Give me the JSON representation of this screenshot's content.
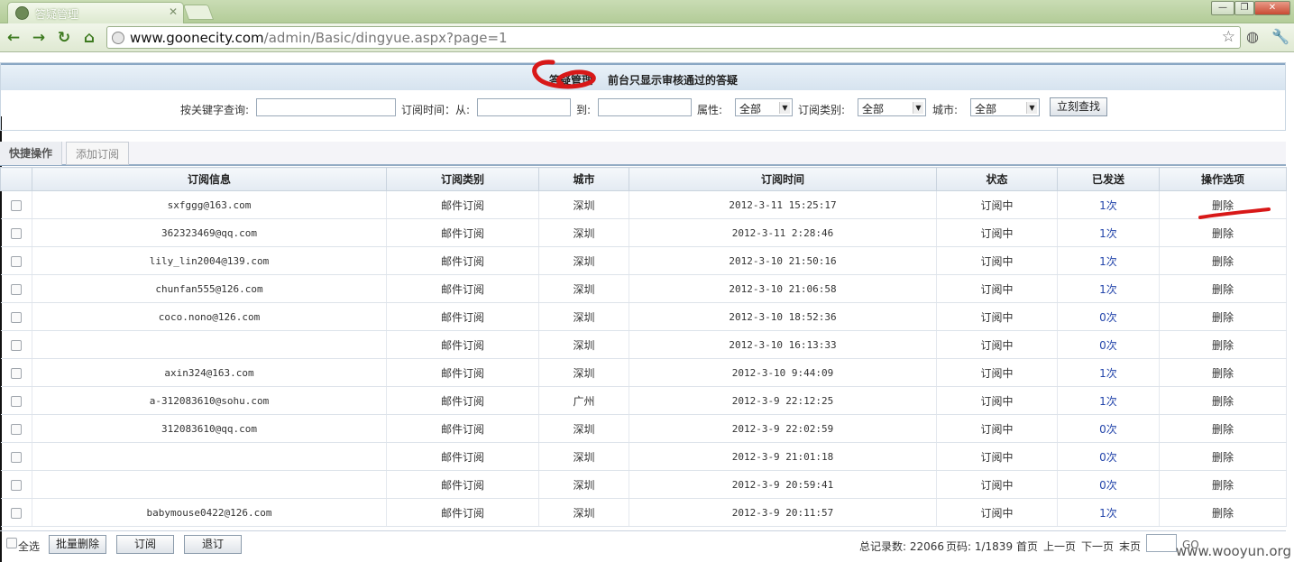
{
  "browser": {
    "tab_title": "答疑管理",
    "url_host": "www.goonecity.com",
    "url_path": "/admin/Basic/dingyue.aspx?page=1"
  },
  "panel": {
    "title": "答疑管理",
    "subtitle": "前台只显示审核通过的答疑"
  },
  "search": {
    "keyword_label": "按关键字查询:",
    "time_from_label": "订阅时间：从:",
    "time_to_label": "到:",
    "attr_label": "属性:",
    "attr_value": "全部",
    "type_label": "订阅类别:",
    "type_value": "全部",
    "city_label": "城市:",
    "city_value": "全部",
    "search_button": "立刻查找"
  },
  "quick": {
    "active_tab": "快捷操作",
    "add_tab": "添加订阅"
  },
  "table": {
    "headers": [
      "订阅信息",
      "订阅类别",
      "城市",
      "订阅时间",
      "状态",
      "已发送",
      "操作选项"
    ],
    "rows": [
      {
        "info": "sxfggg@163.com",
        "type": "邮件订阅",
        "city": "深圳",
        "time": "2012-3-11 15:25:17",
        "status": "订阅中",
        "sent": "1次",
        "action": "删除"
      },
      {
        "info": "362323469@qq.com",
        "type": "邮件订阅",
        "city": "深圳",
        "time": "2012-3-11 2:28:46",
        "status": "订阅中",
        "sent": "1次",
        "action": "删除"
      },
      {
        "info": "lily_lin2004@139.com",
        "type": "邮件订阅",
        "city": "深圳",
        "time": "2012-3-10 21:50:16",
        "status": "订阅中",
        "sent": "1次",
        "action": "删除"
      },
      {
        "info": "chunfan555@126.com",
        "type": "邮件订阅",
        "city": "深圳",
        "time": "2012-3-10 21:06:58",
        "status": "订阅中",
        "sent": "1次",
        "action": "删除"
      },
      {
        "info": "coco.nono@126.com",
        "type": "邮件订阅",
        "city": "深圳",
        "time": "2012-3-10 18:52:36",
        "status": "订阅中",
        "sent": "0次",
        "action": "删除"
      },
      {
        "info": "",
        "type": "邮件订阅",
        "city": "深圳",
        "time": "2012-3-10 16:13:33",
        "status": "订阅中",
        "sent": "0次",
        "action": "删除"
      },
      {
        "info": "axin324@163.com",
        "type": "邮件订阅",
        "city": "深圳",
        "time": "2012-3-10 9:44:09",
        "status": "订阅中",
        "sent": "1次",
        "action": "删除"
      },
      {
        "info": "a-312083610@sohu.com",
        "type": "邮件订阅",
        "city": "广州",
        "time": "2012-3-9 22:12:25",
        "status": "订阅中",
        "sent": "1次",
        "action": "删除"
      },
      {
        "info": "312083610@qq.com",
        "type": "邮件订阅",
        "city": "深圳",
        "time": "2012-3-9 22:02:59",
        "status": "订阅中",
        "sent": "0次",
        "action": "删除"
      },
      {
        "info": "",
        "type": "邮件订阅",
        "city": "深圳",
        "time": "2012-3-9 21:01:18",
        "status": "订阅中",
        "sent": "0次",
        "action": "删除"
      },
      {
        "info": "",
        "type": "邮件订阅",
        "city": "深圳",
        "time": "2012-3-9 20:59:41",
        "status": "订阅中",
        "sent": "0次",
        "action": "删除"
      },
      {
        "info": "babymouse0422@126.com",
        "type": "邮件订阅",
        "city": "深圳",
        "time": "2012-3-9 20:11:57",
        "status": "订阅中",
        "sent": "1次",
        "action": "删除"
      }
    ]
  },
  "footer": {
    "select_all": "全选",
    "batch_delete": "批量删除",
    "subscribe": "订阅",
    "unsubscribe": "退订",
    "total_label": "总记录数: 22066",
    "page_label": "页码: 1/1839",
    "first": "首页",
    "prev": "上一页",
    "next": "下一页",
    "last": "末页",
    "go": "GO"
  },
  "watermark": "www.wooyun.org"
}
